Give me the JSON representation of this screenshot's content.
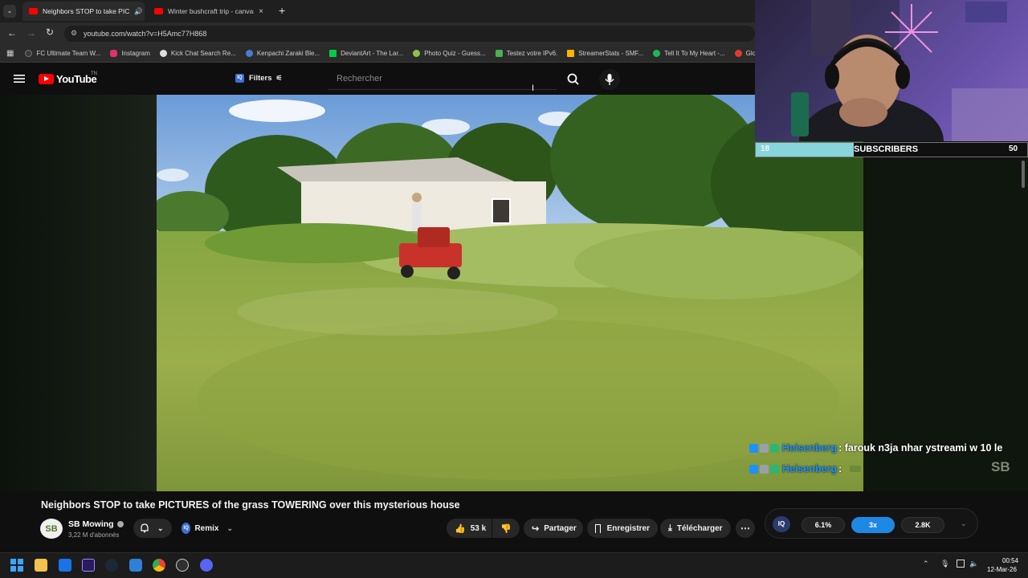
{
  "browser": {
    "tabs": [
      {
        "label": "Neighbors STOP to take PIC",
        "active": true
      },
      {
        "label": "Winter bushcraft trip - canvas h",
        "active": false
      }
    ],
    "url": "youtube.com/watch?v=H5Amc77H868",
    "bookmarks": [
      {
        "label": "FC Ultimate Team W...",
        "color": "#3a3a3a"
      },
      {
        "label": "Instagram",
        "color": "#e1306c"
      },
      {
        "label": "Kick Chat Search Re...",
        "color": "#53fc18"
      },
      {
        "label": "Kenpachi Zaraki Ble...",
        "color": "#4a7bd0"
      },
      {
        "label": "DeviantArt - The Lar...",
        "color": "#05cc47"
      },
      {
        "label": "Photo Quiz - Guess...",
        "color": "#8bc34a"
      },
      {
        "label": "Testez votre IPv6.",
        "color": "#4caf50"
      },
      {
        "label": "StreamerStats - SMF...",
        "color": "#ffb300"
      },
      {
        "label": "Tell It To My Heart -...",
        "color": "#1db954"
      },
      {
        "label": "Globa",
        "color": "#e53935"
      }
    ]
  },
  "youtube": {
    "logo_text": "YouTube",
    "logo_suffix": "TN",
    "filters_label": "Filters",
    "search_placeholder": "Rechercher",
    "video": {
      "title": "Neighbors STOP to take PICTURES of the grass TOWERING over this mysterious house",
      "channel": "SB Mowing",
      "avatar_text": "SB",
      "subscribers": "3,22 M d'abonnés",
      "remix": "Remix",
      "likes": "53 k",
      "share": "Partager",
      "save": "Enregistrer",
      "download": "Télécharger"
    }
  },
  "overlay": {
    "sub_count": "18",
    "sub_label": "SUBSCRIBERS",
    "sub_goal": "50",
    "sub_progress": 0.36,
    "watermark": "SB",
    "chat": [
      {
        "user": "Heisenberg",
        "message": ": farouk n3ja nhar ystreami w 10 le"
      },
      {
        "user": "Heisenberg",
        "message": ":"
      }
    ]
  },
  "iq": {
    "logo": "IQ",
    "stat1": "6.1%",
    "stat2": "3x",
    "stat3": "2.8K"
  },
  "taskbar": {
    "time": "00:54",
    "date": "12-Mar-26"
  },
  "colors": {
    "youtube_red": "#ff0000",
    "sub_fill": "#88d4dc",
    "chat_user": "#1e90ff",
    "iq_blue": "#1e88e5"
  }
}
